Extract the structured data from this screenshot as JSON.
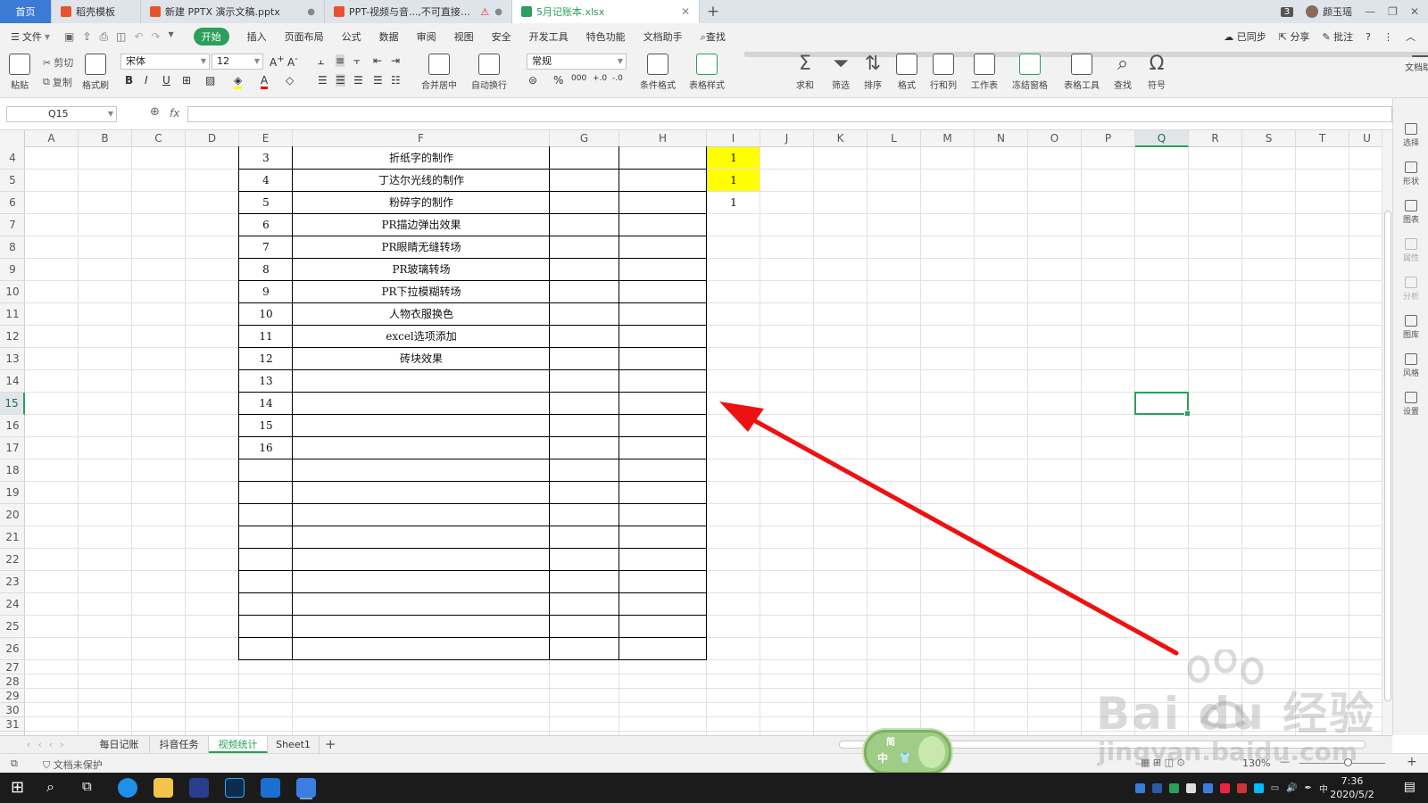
{
  "tabs": [
    {
      "label": "首页",
      "color": "#3c7bd5"
    },
    {
      "label": "稻壳模板",
      "color": "#e8532e"
    },
    {
      "label": "新建 PPTX 演示文稿.pptx",
      "color": "#e8532e"
    },
    {
      "label": "PPT-视频与音...,不可直接商用)",
      "color": "#e8532e"
    },
    {
      "label": "5月记账本.xlsx",
      "color": "#2aa05a"
    }
  ],
  "titlebar": {
    "badge": "3",
    "user": "颜玉瑶"
  },
  "menu": {
    "file": "文件",
    "items": [
      "开始",
      "插入",
      "页面布局",
      "公式",
      "数据",
      "审阅",
      "视图",
      "安全",
      "开发工具",
      "特色功能",
      "文档助手"
    ],
    "search": "查找",
    "sync": "已同步",
    "share": "分享",
    "comment": "批注"
  },
  "ribbon": {
    "clipboard": {
      "paste": "粘贴",
      "cut": "剪切",
      "copy": "复制",
      "format_painter": "格式刷"
    },
    "font": "宋体",
    "size": "12",
    "number_format": "常规",
    "merge": "合并居中",
    "wrap": "自动换行",
    "tools": [
      "条件格式",
      "表格样式",
      "文档助手",
      "求和",
      "筛选",
      "排序",
      "格式",
      "行和列",
      "工作表",
      "冻结窗格",
      "表格工具",
      "查找",
      "符号"
    ]
  },
  "formula": {
    "cell_ref": "Q15",
    "fx": "fx",
    "value": ""
  },
  "grid": {
    "columns": [
      "A",
      "B",
      "C",
      "D",
      "E",
      "F",
      "G",
      "H",
      "I",
      "J",
      "K",
      "L",
      "M",
      "N",
      "O",
      "P",
      "Q",
      "R",
      "S",
      "T",
      "U"
    ],
    "rows": [
      "4",
      "5",
      "6",
      "7",
      "8",
      "9",
      "10",
      "11",
      "12",
      "13",
      "14",
      "15",
      "16",
      "17",
      "18",
      "19",
      "20",
      "21",
      "22",
      "23",
      "24",
      "25",
      "26",
      "27",
      "28",
      "29",
      "30",
      "31"
    ],
    "selected_cell": "Q15",
    "table_rows": [
      {
        "num": "3",
        "name": "折纸字的制作",
        "mark": "1",
        "highlight": true
      },
      {
        "num": "4",
        "name": "丁达尔光线的制作",
        "mark": "1",
        "highlight": true
      },
      {
        "num": "5",
        "name": "粉碎字的制作",
        "mark": "1",
        "highlight": false
      },
      {
        "num": "6",
        "name": "PR描边弹出效果",
        "mark": "",
        "highlight": false
      },
      {
        "num": "7",
        "name": "PR眼睛无缝转场",
        "mark": "",
        "highlight": false
      },
      {
        "num": "8",
        "name": "PR玻璃转场",
        "mark": "",
        "highlight": false
      },
      {
        "num": "9",
        "name": "PR下拉模糊转场",
        "mark": "",
        "highlight": false
      },
      {
        "num": "10",
        "name": "人物衣服换色",
        "mark": "",
        "highlight": false
      },
      {
        "num": "11",
        "name": "excel选项添加",
        "mark": "",
        "highlight": false
      },
      {
        "num": "12",
        "name": "砖块效果",
        "mark": "",
        "highlight": false
      },
      {
        "num": "13",
        "name": "",
        "mark": "",
        "highlight": false
      },
      {
        "num": "14",
        "name": "",
        "mark": "",
        "highlight": false
      },
      {
        "num": "15",
        "name": "",
        "mark": "",
        "highlight": false
      },
      {
        "num": "16",
        "name": "",
        "mark": "",
        "highlight": false
      }
    ]
  },
  "right_panel": [
    "选择",
    "形状",
    "图表",
    "属性",
    "分析",
    "图库",
    "风格",
    "设置"
  ],
  "sheets": [
    "每日记账",
    "抖音任务",
    "视频统计",
    "Sheet1"
  ],
  "active_sheet": "视频统计",
  "status": {
    "protect": "文档未保护",
    "zoom": "130%"
  },
  "ime": {
    "mode1": "简",
    "mode2": "中"
  },
  "taskbar": {
    "time": "7:36",
    "date": "2020/5/2",
    "ime": "中"
  },
  "watermark": {
    "brand": "Bai du 经验",
    "url": "jingyan.baidu.com"
  },
  "colors": {
    "accent": "#2aa05a",
    "highlight": "#ffff00",
    "arrow": "#ee1111",
    "home_tab": "#3c7bd5"
  }
}
